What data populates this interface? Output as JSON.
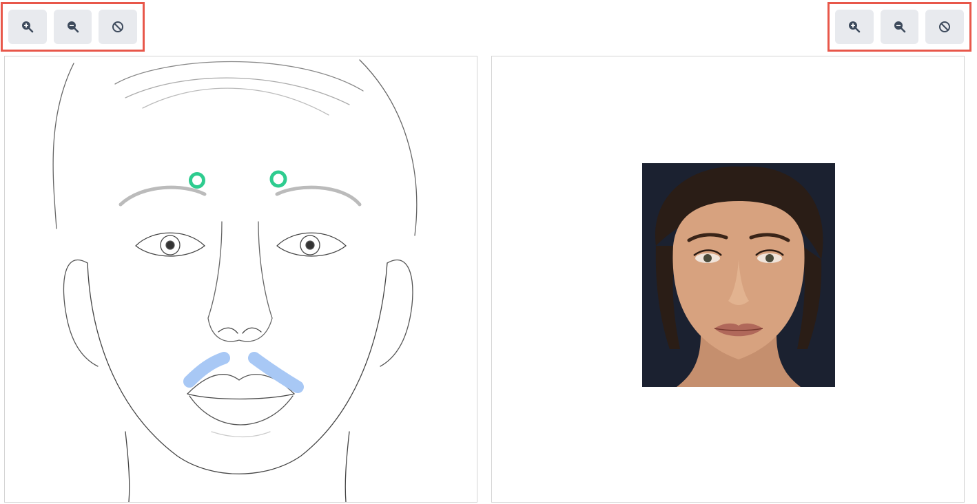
{
  "left_toolbar": {
    "zoom_in_icon": "zoom-in-icon",
    "zoom_out_icon": "zoom-out-icon",
    "reset_icon": "reset-icon"
  },
  "right_toolbar": {
    "zoom_in_icon": "zoom-in-icon",
    "zoom_out_icon": "zoom-out-icon",
    "reset_icon": "reset-icon"
  },
  "colors": {
    "highlight_border": "#e8574a",
    "button_bg": "#e8eaee",
    "icon": "#3d4a5c",
    "marker_green": "#2ecc8f",
    "marker_blue": "#a8c8f5"
  }
}
